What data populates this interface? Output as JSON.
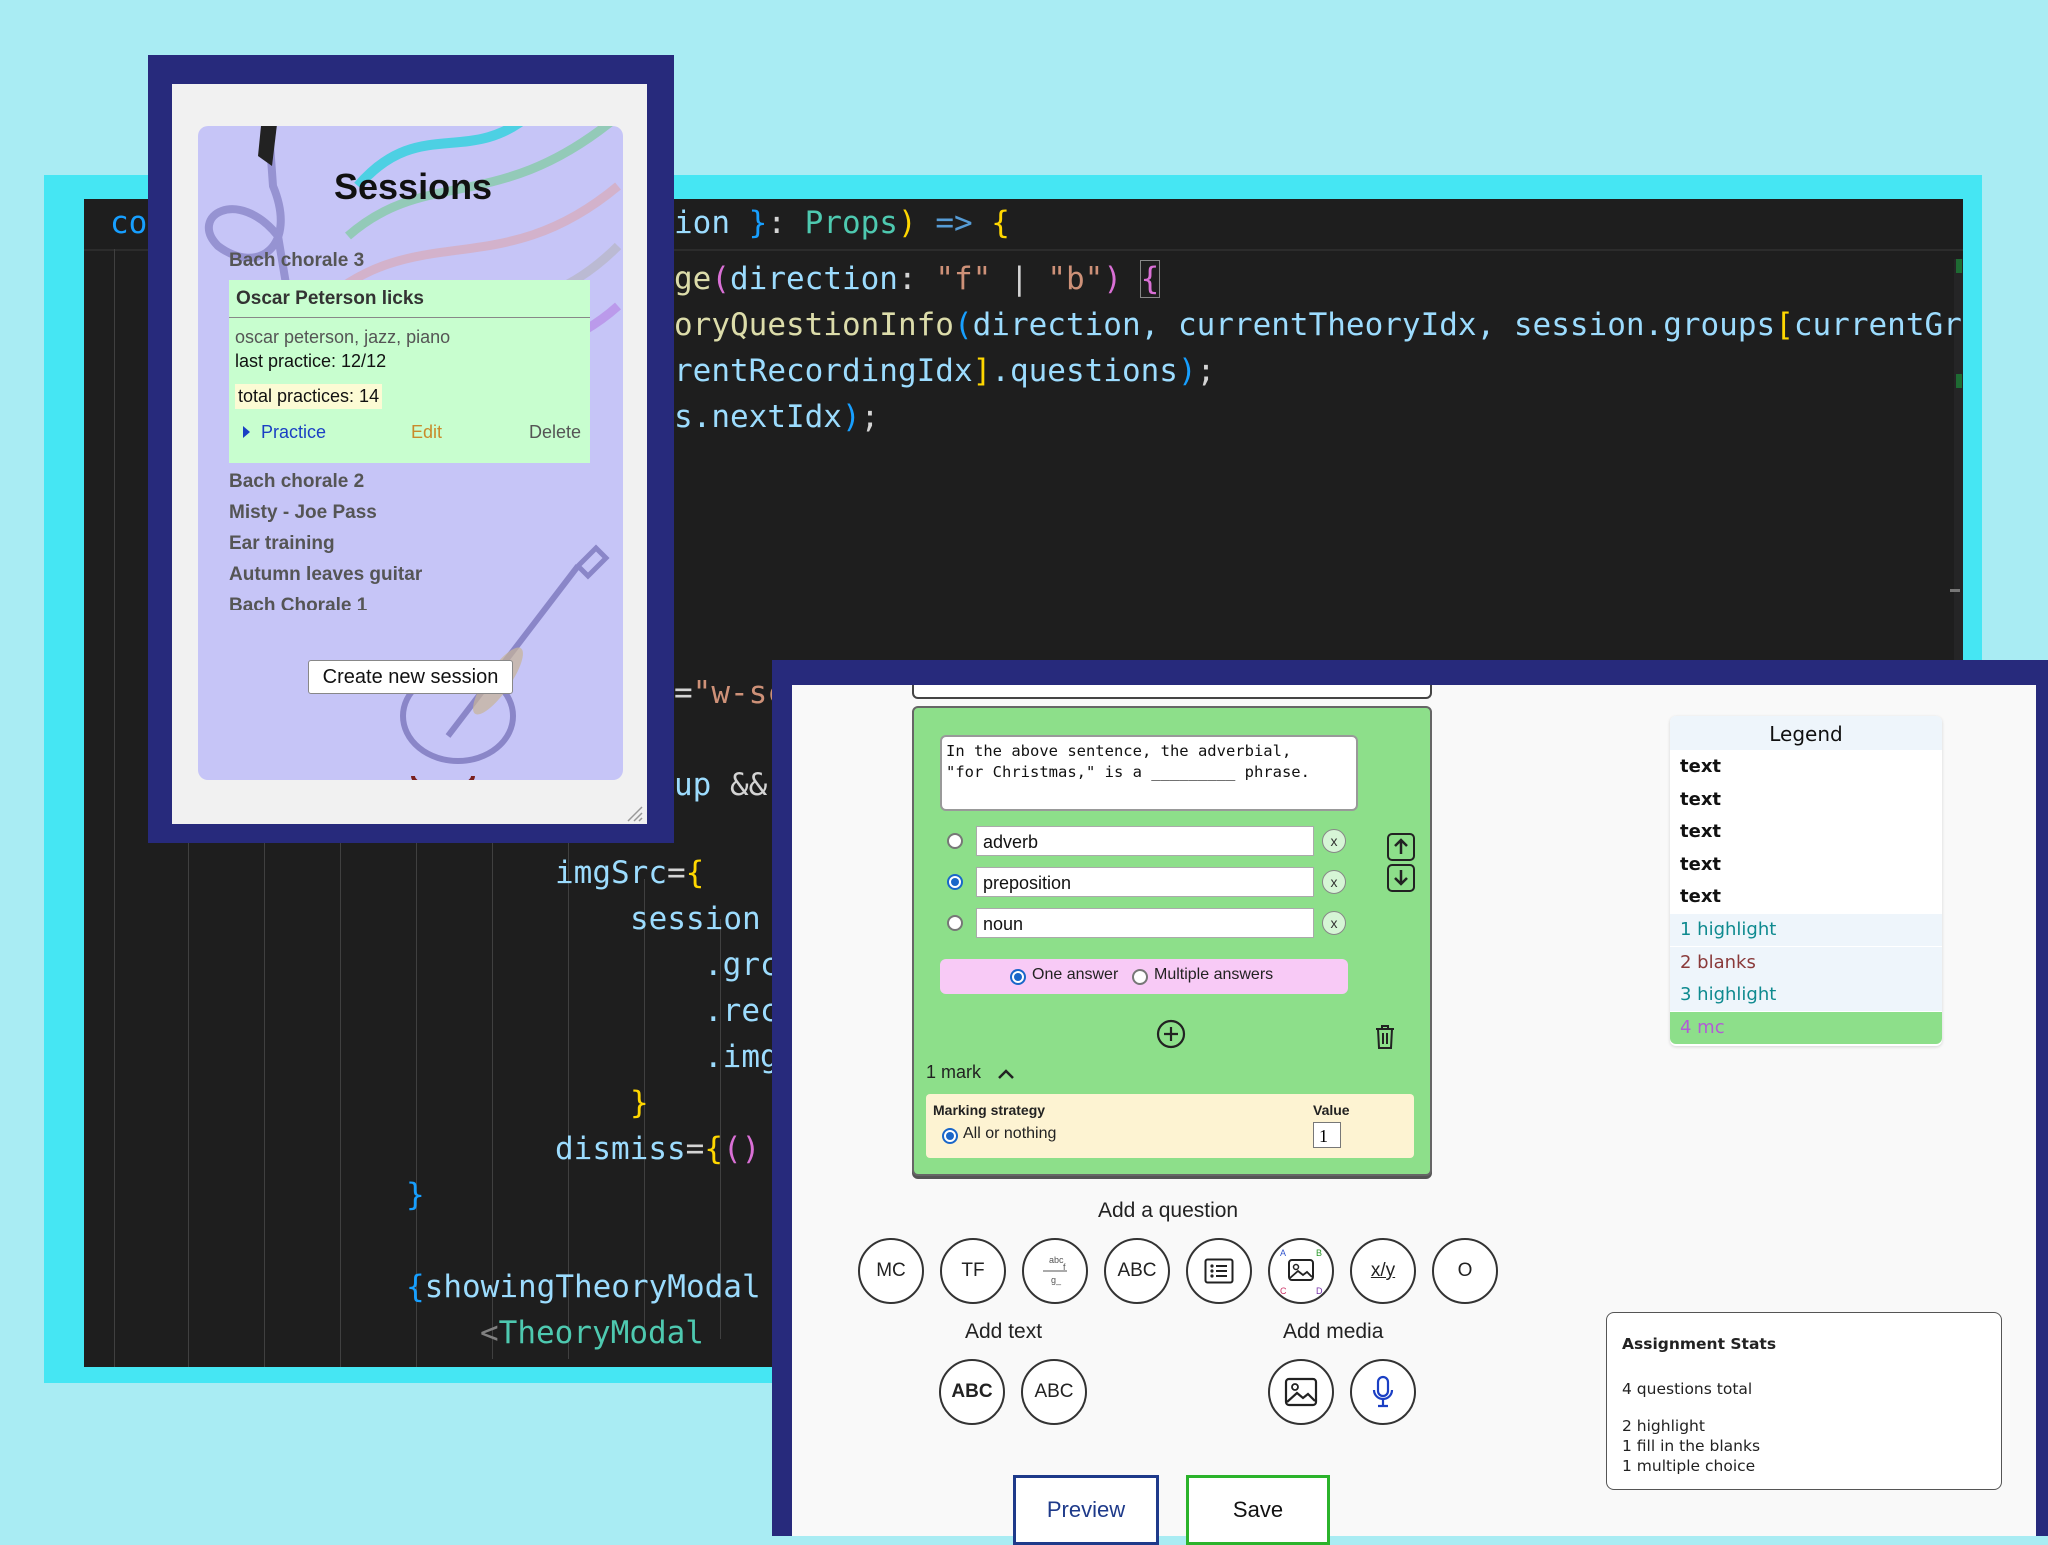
{
  "editor": {
    "line1": {
      "a": "co",
      "b": "ion ",
      "c": "}",
      "d": ": ",
      "e": "Props",
      "f": ") ",
      "g": "=>",
      "h": " {"
    },
    "line2": {
      "a": "ge",
      "b": "(",
      "c": "direction",
      "d": ": ",
      "e": "\"f\"",
      "f": " | ",
      "g": "\"b\"",
      "h": ") ",
      "i": "{"
    },
    "line3": {
      "a": "oryQuestionInfo",
      "b": "(",
      "c": "direction, currentTheoryIdx, session.groups",
      "d": "[",
      "e": "currentGro"
    },
    "line4": {
      "a": "rentRecordingIdx",
      "b": "]",
      "c": ".questions",
      "d": ")",
      "e": ";"
    },
    "line5": {
      "a": "s.nextIdx",
      "b": ")",
      "c": ";"
    },
    "line6": {
      "a": "=",
      "b": "\"w-sc"
    },
    "line7": {
      "a": "up ",
      "b": "&&"
    },
    "line8": {
      "a": "imgSrc",
      "b": "=",
      "c": "{"
    },
    "line9": {
      "a": "session"
    },
    "line10": {
      "a": ".grc"
    },
    "line11": {
      "a": ".rec"
    },
    "line12": {
      "a": ".img"
    },
    "line13": {
      "a": "}"
    },
    "line14": {
      "a": "dismiss",
      "b": "=",
      "c": "{",
      "d": "()"
    },
    "line15": {
      "a": "}"
    },
    "line16": {
      "a": "{",
      "b": "showingTheoryModal"
    },
    "line17": {
      "a": "<",
      "b": "TheoryModal"
    }
  },
  "sessions": {
    "title": "Sessions",
    "items_above": [
      "Bach chorale 3"
    ],
    "selected": {
      "name": "Oscar Peterson licks",
      "tags": "oscar peterson, jazz, piano",
      "last_practice": "last practice: 12/12",
      "total_practices": "total practices: 14",
      "practice_label": "Practice",
      "edit_label": "Edit",
      "delete_label": "Delete"
    },
    "items_below": [
      "Bach chorale 2",
      "Misty - Joe Pass",
      "Ear training",
      "Autumn leaves guitar",
      "Bach Chorale 1"
    ],
    "create_button": "Create new session"
  },
  "question": {
    "prompt_line1": "In the above sentence, the adverbial,",
    "prompt_line2": "\"for Christmas,\" is a _________ phrase.",
    "options": [
      {
        "value": "adverb",
        "selected": false
      },
      {
        "value": "preposition",
        "selected": true
      },
      {
        "value": "noun",
        "selected": false
      }
    ],
    "remove_label": "x",
    "mode_one": "One answer",
    "mode_multiple": "Multiple answers",
    "marks": "1 mark",
    "marking_strategy_label": "Marking strategy",
    "marking_strategy_value": "All or nothing",
    "value_label": "Value",
    "value": "1"
  },
  "add_question": {
    "title": "Add a question",
    "buttons": [
      {
        "label": "MC",
        "name": "add-mc-button"
      },
      {
        "label": "TF",
        "name": "add-tf-button"
      },
      {
        "label": "",
        "name": "add-fraction-button",
        "icon": "fraction-icon"
      },
      {
        "label": "ABC",
        "name": "add-highlight-button"
      },
      {
        "label": "",
        "name": "add-list-button",
        "icon": "list-icon"
      },
      {
        "label": "",
        "name": "add-image-label-button",
        "icon": "image-label-icon"
      },
      {
        "label": "x/y",
        "name": "add-xy-button"
      },
      {
        "label": "O",
        "name": "add-other-button"
      }
    ]
  },
  "add_text": {
    "title": "Add text",
    "bold_label": "ABC",
    "plain_label": "ABC"
  },
  "add_media": {
    "title": "Add media"
  },
  "actions": {
    "preview": "Preview",
    "save": "Save"
  },
  "legend": {
    "title": "Legend",
    "items": [
      {
        "label": "text",
        "color": "#111111"
      },
      {
        "label": "text",
        "color": "#111111"
      },
      {
        "label": "text",
        "color": "#111111"
      },
      {
        "label": "text",
        "color": "#111111"
      },
      {
        "label": "text",
        "color": "#111111"
      },
      {
        "label": "1 highlight",
        "color": "#0e8a8f"
      },
      {
        "label": "2 blanks",
        "color": "#8a3a3a"
      },
      {
        "label": "3 highlight",
        "color": "#0e8a8f"
      },
      {
        "label": "4 mc",
        "color": "#b25bd6"
      }
    ]
  },
  "stats": {
    "title": "Assignment Stats",
    "total": "4 questions total",
    "line1": "2 highlight",
    "line2": "1 fill in the blanks",
    "line3": "1 multiple choice"
  },
  "colors": {
    "background": "#a9ecf3",
    "frame": "#272a7c",
    "question_card": "#8ddf8a",
    "legend_active": "#8ddf8a",
    "accent_blue": "#1a66c9",
    "save_border": "#2bb32b"
  }
}
